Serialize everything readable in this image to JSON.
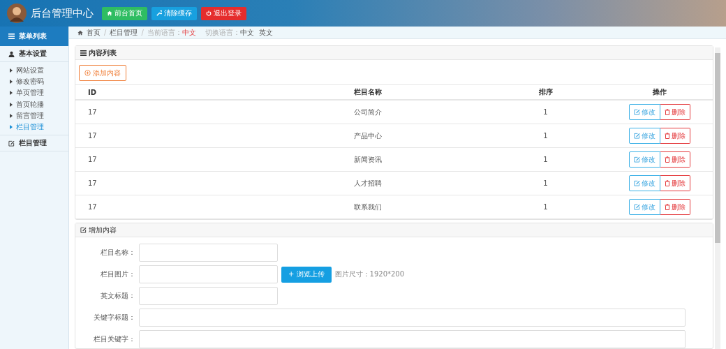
{
  "header": {
    "title": "后台管理中心",
    "buttons": [
      {
        "label": "前台首页",
        "kind": "home"
      },
      {
        "label": "清除缓存",
        "kind": "clear"
      },
      {
        "label": "退出登录",
        "kind": "logout"
      }
    ]
  },
  "sidebar": {
    "title": "菜单列表",
    "groups": [
      {
        "label": "基本设置",
        "kind": "user",
        "expanded": true,
        "children": [
          {
            "label": "网站设置",
            "selected": false
          },
          {
            "label": "修改密码",
            "selected": false
          },
          {
            "label": "单页管理",
            "selected": false
          },
          {
            "label": "首页轮播",
            "selected": false
          },
          {
            "label": "留言管理",
            "selected": false
          },
          {
            "label": "栏目管理",
            "selected": true
          }
        ]
      },
      {
        "label": "栏目管理",
        "kind": "edit",
        "expanded": false
      }
    ]
  },
  "breadcrumb": {
    "items": [
      "首页",
      "栏目管理"
    ],
    "separator": "/",
    "language_label": "当前语言：",
    "language": "中文",
    "switch_label": "切换语言：",
    "switch_options": [
      "中文",
      "英文"
    ]
  },
  "content_list": {
    "title": "内容列表",
    "add_button": "添加内容",
    "columns": [
      "ID",
      "栏目名称",
      "排序",
      "操作"
    ],
    "rows": [
      {
        "id": "17",
        "name": "公司简介",
        "order": "1",
        "edit": "修改",
        "delete": "删除"
      },
      {
        "id": "17",
        "name": "产品中心",
        "order": "1",
        "edit": "修改",
        "delete": "删除"
      },
      {
        "id": "17",
        "name": "新闻资讯",
        "order": "1",
        "edit": "修改",
        "delete": "删除"
      },
      {
        "id": "17",
        "name": "人才招聘",
        "order": "1",
        "edit": "修改",
        "delete": "删除"
      },
      {
        "id": "17",
        "name": "联系我们",
        "order": "1",
        "edit": "修改",
        "delete": "删除"
      }
    ]
  },
  "add_form": {
    "title": "增加内容",
    "fields": [
      {
        "label": "栏目名称：",
        "kind": "short"
      },
      {
        "label": "栏目图片：",
        "kind": "upload",
        "button": "+ 浏览上传",
        "hint": "图片尺寸：1920*200"
      },
      {
        "label": "英文标题：",
        "kind": "short"
      },
      {
        "label": "关键字标题：",
        "kind": "wide"
      },
      {
        "label": "栏目关键字：",
        "kind": "wide"
      }
    ]
  }
}
